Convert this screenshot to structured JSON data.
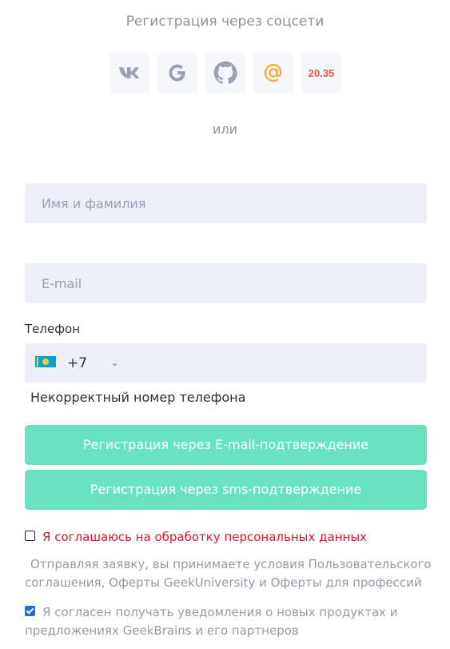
{
  "title": "Регистрация через соцсети",
  "socials": [
    {
      "name": "vk",
      "label": "VK"
    },
    {
      "name": "google",
      "label": "G"
    },
    {
      "name": "github",
      "label": "GitHub"
    },
    {
      "name": "mailru",
      "label": "@"
    },
    {
      "name": "yandex-2035",
      "label": "20.35"
    }
  ],
  "or_text": "или",
  "form": {
    "name_placeholder": "Имя и фамилия",
    "email_placeholder": "E-mail",
    "phone_label": "Телефон",
    "phone_code": "+7",
    "phone_value": "",
    "phone_error": "Некорректный номер телефона"
  },
  "buttons": {
    "email_register": "Регистрация через E-mail-подтверждение",
    "sms_register": "Регистрация через sms-подтверждение"
  },
  "consent": {
    "personal_data_label": "Я соглашаюсь на обработку персональных данных",
    "personal_data_checked": false,
    "terms_note": "Отправляя заявку, вы принимаете условия Пользовательского соглашения, Оферты GeekUniversity и Оферты для професcий",
    "notifications_label": "Я согласен получать уведомления о новых продуктах и предложениях GeekBrains и его партнеров",
    "notifications_checked": true
  },
  "colors": {
    "accent_button": "#69e3bf",
    "field_bg": "#eceef8",
    "error_text": "#e0132a",
    "checkbox_checked": "#1d6fd6"
  }
}
